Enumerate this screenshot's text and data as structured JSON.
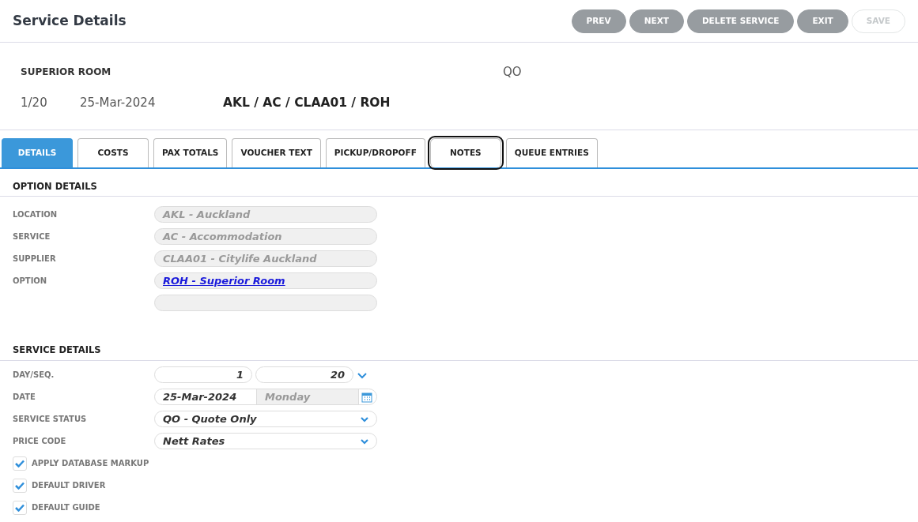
{
  "header": {
    "title": "Service Details",
    "buttons": [
      {
        "label": "PREV",
        "disabled": false
      },
      {
        "label": "NEXT",
        "disabled": false
      },
      {
        "label": "DELETE SERVICE",
        "disabled": false
      },
      {
        "label": "EXIT",
        "disabled": false
      },
      {
        "label": "SAVE",
        "disabled": true
      }
    ]
  },
  "summary": {
    "name": "SUPERIOR ROOM",
    "status": "QO",
    "day_seq": "1/20",
    "date": "25-Mar-2024",
    "code": "AKL / AC / CLAA01 / ROH"
  },
  "tabs": [
    {
      "label": "DETAILS",
      "selected": true,
      "focused": false
    },
    {
      "label": "COSTS",
      "selected": false,
      "focused": false
    },
    {
      "label": "PAX TOTALS",
      "selected": false,
      "focused": false
    },
    {
      "label": "VOUCHER TEXT",
      "selected": false,
      "focused": false
    },
    {
      "label": "PICKUP/DROPOFF",
      "selected": false,
      "focused": false
    },
    {
      "label": "NOTES",
      "selected": false,
      "focused": true
    },
    {
      "label": "QUEUE ENTRIES",
      "selected": false,
      "focused": false
    }
  ],
  "option_details": {
    "heading": "OPTION DETAILS",
    "rows": [
      {
        "kind": "text",
        "label": "LOCATION",
        "value": "AKL - Auckland"
      },
      {
        "kind": "text",
        "label": "SERVICE",
        "value": "AC - Accommodation"
      },
      {
        "kind": "text",
        "label": "SUPPLIER",
        "value": "CLAA01 - Citylife Auckland"
      },
      {
        "kind": "link",
        "label": "OPTION",
        "value": "ROH - Superior Room"
      },
      {
        "kind": "blank"
      }
    ]
  },
  "service_details": {
    "heading": "SERVICE DETAILS",
    "rows": [
      {
        "kind": "pair",
        "label": "DAY/SEQ.",
        "value": "1",
        "value_2": "20"
      },
      {
        "kind": "date",
        "label": "DATE",
        "value": "25-Mar-2024",
        "weekday": "Monday"
      },
      {
        "kind": "select",
        "label": "SERVICE STATUS",
        "value": "QO - Quote Only"
      },
      {
        "kind": "select",
        "label": "PRICE CODE",
        "value": "Nett Rates"
      }
    ],
    "checkboxes": [
      {
        "label": "APPLY DATABASE MARKUP",
        "checked": true
      },
      {
        "label": "DEFAULT DRIVER",
        "checked": true
      },
      {
        "label": "DEFAULT GUIDE",
        "checked": true
      }
    ]
  }
}
